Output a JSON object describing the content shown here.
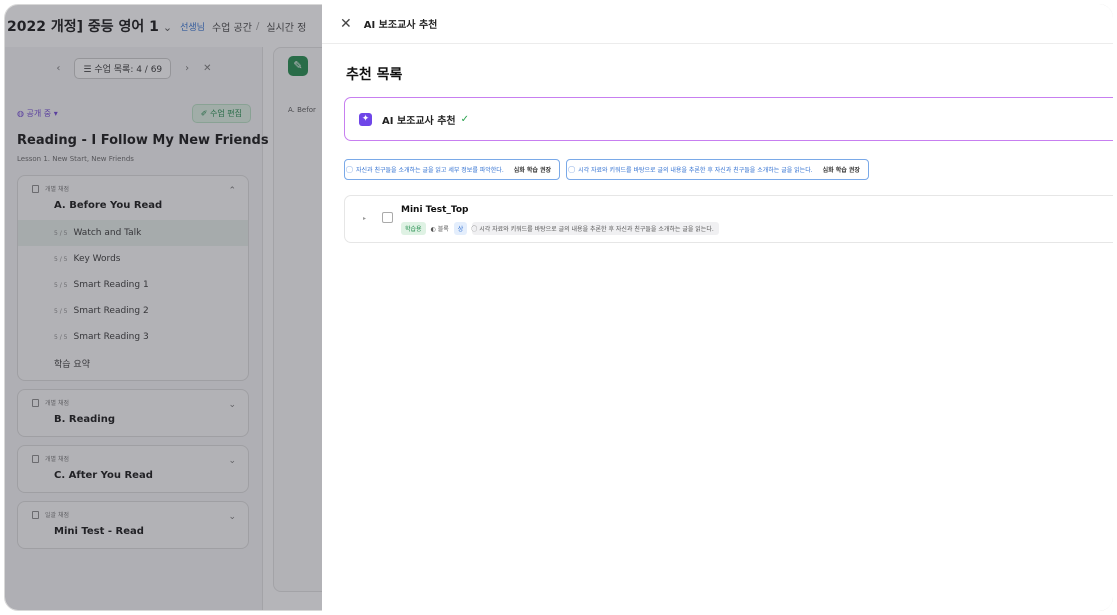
{
  "app": {
    "course_title": "2022 개정] 중등 영어 1",
    "course_caret": "⌄",
    "teacher_badge": "선생님",
    "crumb_space": "수업 공간",
    "crumb_sep": "/",
    "crumb_live": "실시간 정"
  },
  "left": {
    "prev": "‹",
    "next": "›",
    "close": "✕",
    "list_button": "☰ 수업 목록: 4 / 69",
    "status": "◍ 공개 중 ▾",
    "edit_button": "✐ 수업 편집",
    "lesson_title": "Reading - I Follow My New Friends",
    "lesson_sub": "Lesson 1. New Start, New Friends",
    "units": [
      {
        "type": "개별 채점",
        "name": "A. Before You Read",
        "caret": "⌃",
        "items": [
          {
            "prog": "5 / 5",
            "label": "Watch and Talk"
          },
          {
            "prog": "5 / 5",
            "label": "Key Words"
          },
          {
            "prog": "5 / 5",
            "label": "Smart Reading 1"
          },
          {
            "prog": "5 / 5",
            "label": "Smart Reading 2"
          },
          {
            "prog": "5 / 5",
            "label": "Smart Reading 3"
          },
          {
            "prog": "",
            "label": "학습 요약"
          }
        ]
      },
      {
        "type": "개별 채점",
        "name": "B. Reading",
        "caret": "⌄"
      },
      {
        "type": "개별 채점",
        "name": "C. After You Read",
        "caret": "⌄"
      },
      {
        "type": "일괄 채점",
        "name": "Mini Test - Read",
        "caret": "⌄"
      }
    ]
  },
  "mid": {
    "icon": "✎",
    "text": "A. Befor"
  },
  "drawer": {
    "close": "✕",
    "title": "AI 보조교사 추천",
    "section_title": "추천 목록",
    "ai_icon": "✦",
    "ai_label": "AI 보조교사 추천",
    "ai_check": "✓",
    "goals": [
      {
        "text": "자신과 친구들을 소개하는 글을 읽고 세부 정보를 파악한다.",
        "rec": "심화 학습 권장"
      },
      {
        "text": "시각 자료와 키워드를 바탕으로 글의 내용을 추론한 후 자신과 친구들을 소개하는 글을 읽는다.",
        "rec": "심화 학습 권장"
      }
    ],
    "test": {
      "caret": "▸",
      "name": "Mini Test_Top",
      "badge": "학습용",
      "meta": "◐ 블록",
      "level": "상",
      "goal": "⃝ 시각 자료와 키워드를 바탕으로 글의 내용을 추론한 후 자신과 친구들을 소개하는 글을 읽는다."
    }
  },
  "colors": {
    "accent_purple": "#6f46e8",
    "card_border": "#c77ff0",
    "chip_blue": "#2f6fd1",
    "green": "#1e8a4a"
  }
}
